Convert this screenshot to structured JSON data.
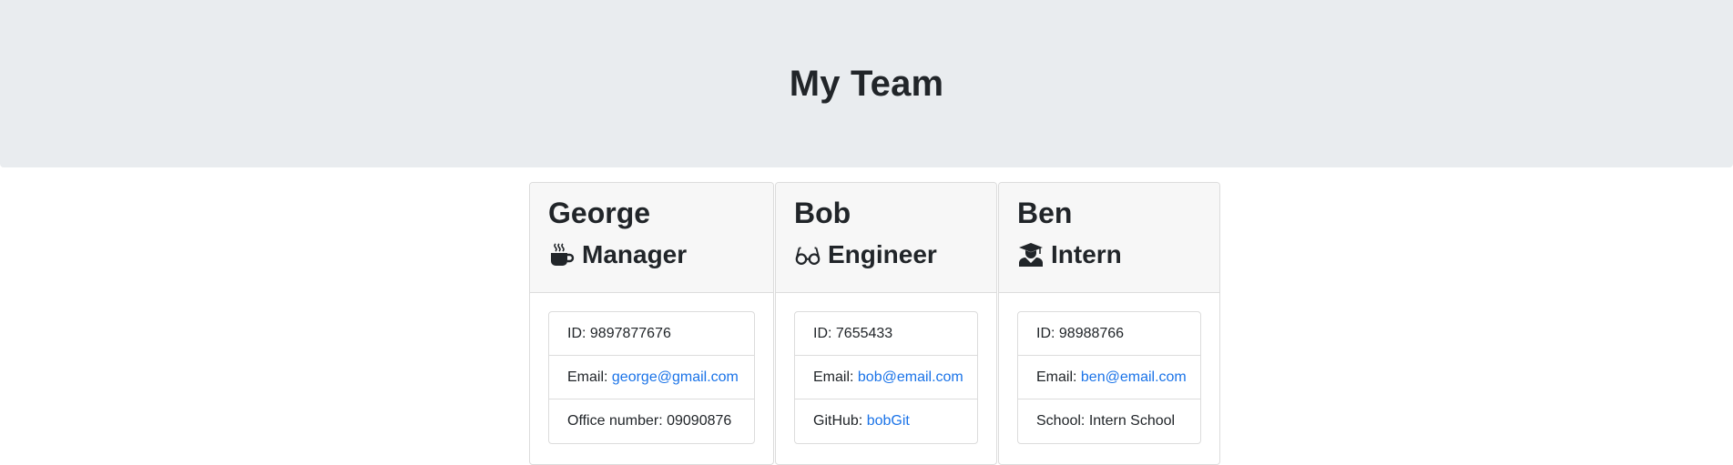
{
  "header": {
    "title": "My Team"
  },
  "team": [
    {
      "name": "George",
      "role": "Manager",
      "icon": "coffee-mug-icon",
      "id_label": "ID: ",
      "id": "9897877676",
      "email_label": "Email: ",
      "email": "george@gmail.com",
      "extra_label": "Office number: ",
      "extra_value": "09090876"
    },
    {
      "name": "Bob",
      "role": "Engineer",
      "icon": "glasses-icon",
      "id_label": "ID: ",
      "id": "7655433",
      "email_label": "Email: ",
      "email": "bob@email.com",
      "extra_label": "GitHub: ",
      "extra_value": "bobGit"
    },
    {
      "name": "Ben",
      "role": "Intern",
      "icon": "graduate-icon",
      "id_label": "ID: ",
      "id": "98988766",
      "email_label": "Email: ",
      "email": "ben@email.com",
      "extra_label": "School: ",
      "extra_value": "Intern School"
    }
  ],
  "colors": {
    "link": "#1a73e8",
    "jumbotron": "#e9ecef",
    "card_header": "#f7f7f7"
  }
}
